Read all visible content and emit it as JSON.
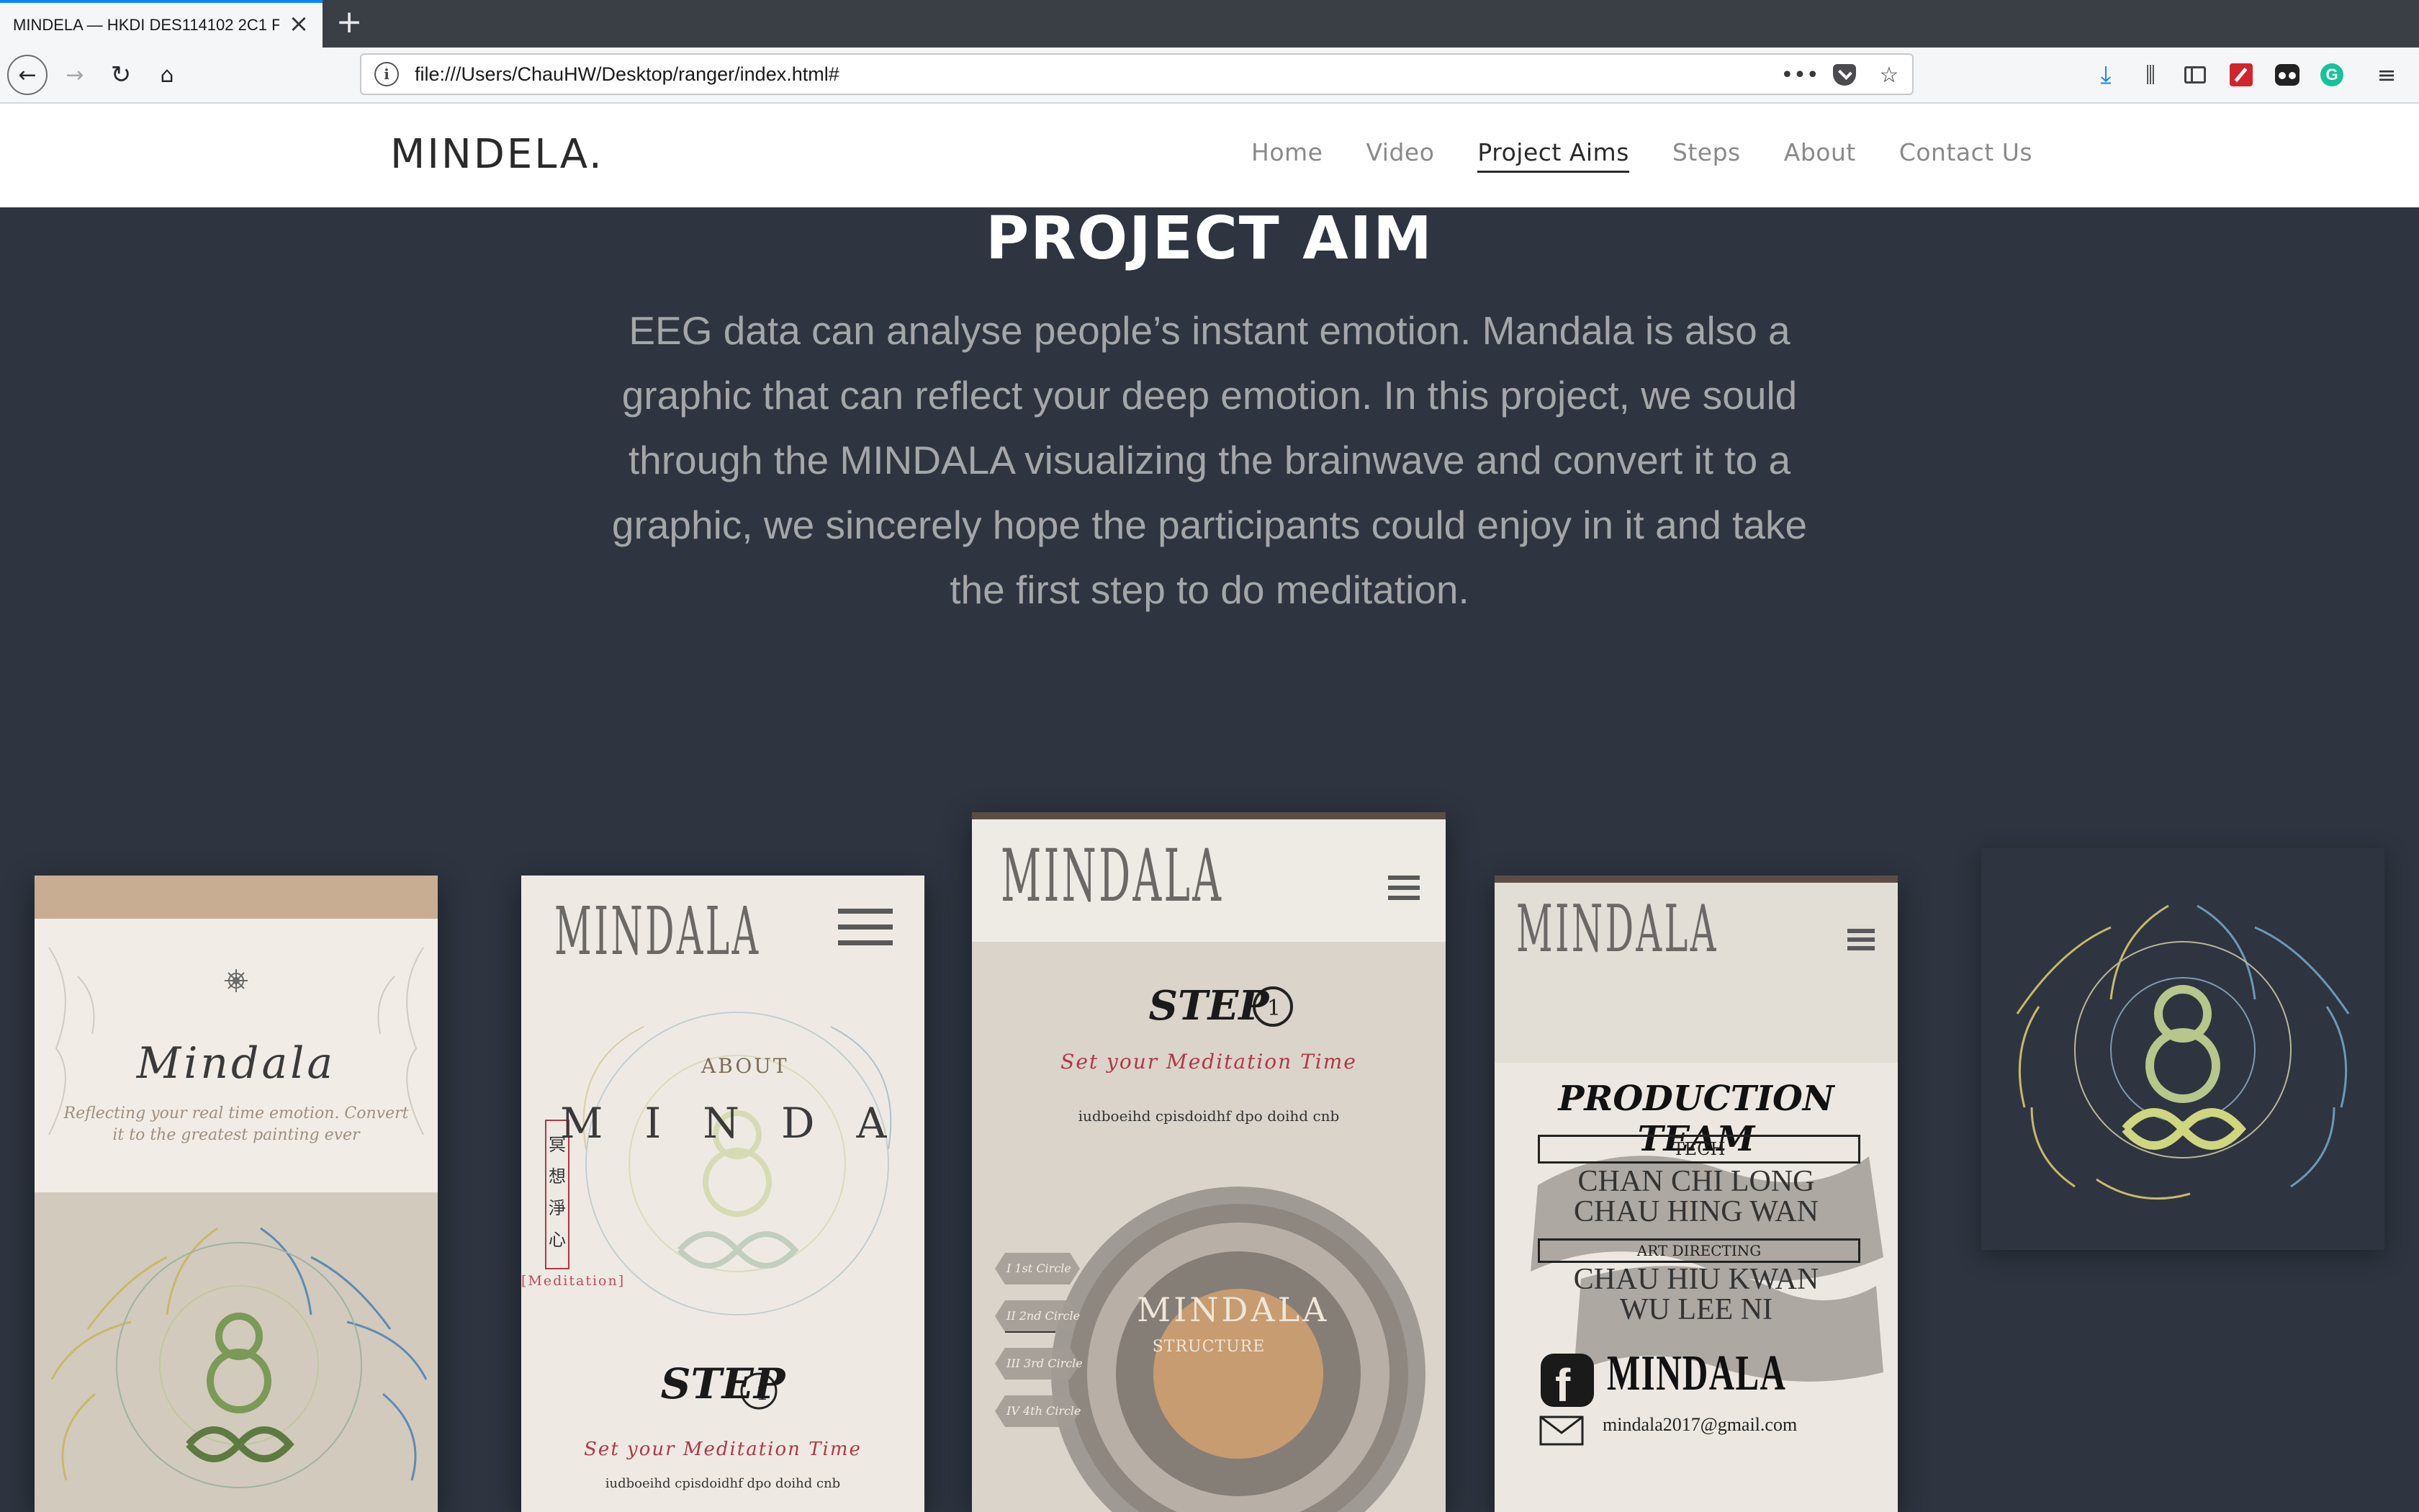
{
  "browser": {
    "tab_title": "MINDELA — HKDI DES114102 2C1 F",
    "url": "file:///Users/ChauHW/Desktop/ranger/index.html#"
  },
  "site": {
    "logo": "MINDELA.",
    "nav": [
      "Home",
      "Video",
      "Project Aims",
      "Steps",
      "About",
      "Contact Us"
    ],
    "active_nav": "Project Aims"
  },
  "aim": {
    "title": "PROJECT AIM",
    "text": "EEG data can analyse people’s instant emotion. Mandala is also a graphic that can reflect your deep emotion. In this project, we sould through the MINDALA visualizing the brainwave and convert it to a graphic, we sincerely hope the participants could enjoy in it and take the first step to do meditation."
  },
  "mockups": {
    "p1": {
      "title": "Mindala",
      "tagline": "Reflecting your real time emotion. Convert it to the greatest painting ever"
    },
    "p2": {
      "logo": "MINDALA",
      "about": "ABOUT",
      "mindala": "MINDALA",
      "chinese": "冥想淨心",
      "meditation": "[Meditation]",
      "step": "STEP",
      "step_num": "1",
      "set_time": "Set your Meditation Time",
      "filler": "iudboeihd cpisdoidhf dpo doihd cnb"
    },
    "p3": {
      "logo": "MINDALA",
      "step": "STEP",
      "step_num": "1",
      "set_time": "Set your Meditation Time",
      "filler": "iudboeihd cpisdoidhf dpo doihd cnb",
      "center_title": "MINDALA",
      "center_sub": "STRUCTURE",
      "circles": [
        "I  1st Circle",
        "II  2nd Circle",
        "III  3rd Circle",
        "IV  4th Circle"
      ]
    },
    "p4": {
      "logo": "MINDALA",
      "production": "PRODUCTION TEAM",
      "tech_label": "TECH",
      "tech_names": [
        "CHAN CHI LONG",
        "CHAU HING WAN"
      ],
      "art_label": "ART DIRECTING",
      "art_names": [
        "CHAU HIU KWAN",
        "WU LEE NI"
      ],
      "brand": "MINDALA",
      "email": "mindala2017@gmail.com"
    }
  },
  "colors": {
    "page_bg": "#2e3540",
    "text_muted": "#a4a6a9",
    "accent_red": "#b03848",
    "tab_highlight": "#0a84ff"
  }
}
